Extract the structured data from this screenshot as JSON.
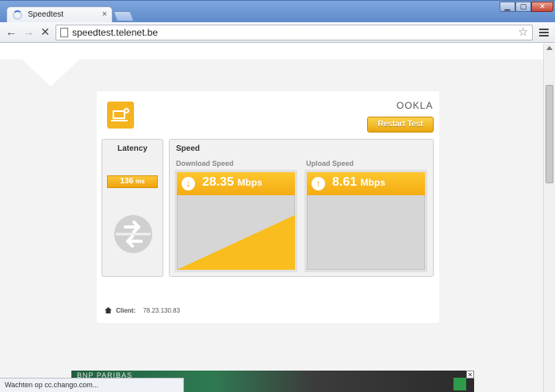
{
  "browser": {
    "tab_title": "Speedtest",
    "tab_close": "×",
    "url": "speedtest.telenet.be",
    "status_text": "Wachten op cc.chango.com..."
  },
  "speedtest": {
    "brand": "OOKLA",
    "restart_label": "Restart Test",
    "latency": {
      "label": "Latency",
      "value": "136",
      "unit": "ms"
    },
    "speed": {
      "label": "Speed",
      "download": {
        "label": "Download Speed",
        "value": "28.35",
        "unit": "Mbps"
      },
      "upload": {
        "label": "Upload Speed",
        "value": "8.61",
        "unit": "Mbps"
      }
    },
    "client": {
      "label": "Client:",
      "ip": "78.23.130.83"
    }
  },
  "ad": {
    "brand": "BNP PARIBAS"
  },
  "colors": {
    "accent": "#f4ac12",
    "panel_bg": "#f1f1f1"
  }
}
